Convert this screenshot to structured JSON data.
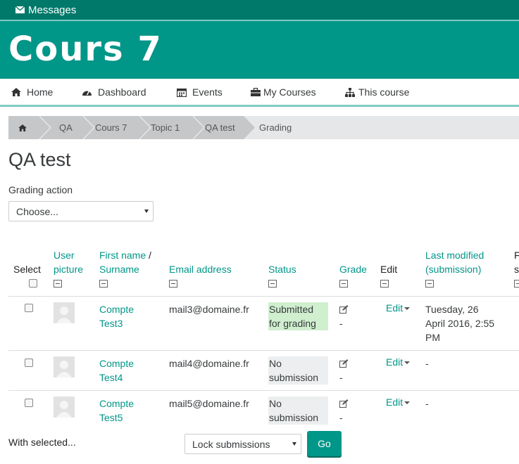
{
  "topbar": {
    "messages_label": "Messages",
    "icon": "envelope-icon"
  },
  "banner": {
    "title": "Cours 7"
  },
  "nav": {
    "items": [
      {
        "label": "Home",
        "icon": "home-icon"
      },
      {
        "label": "Dashboard",
        "icon": "dashboard-icon"
      },
      {
        "label": "Events",
        "icon": "calendar-icon"
      },
      {
        "label": "My Courses",
        "icon": "briefcase-icon"
      },
      {
        "label": "This course",
        "icon": "sitemap-icon"
      }
    ]
  },
  "breadcrumb": {
    "items": [
      "QA",
      "Cours 7",
      "Topic 1",
      "QA test",
      "Grading"
    ],
    "home_icon": "home-icon"
  },
  "page": {
    "title": "QA test",
    "grading_action_label": "Grading action",
    "grading_action_value": "Choose..."
  },
  "table": {
    "headers": {
      "select": "Select",
      "user_picture_1": "User",
      "user_picture_2": "picture",
      "first_name": "First name",
      "name_sep": " /",
      "surname": "Surname",
      "email": "Email address",
      "status": "Status",
      "grade": "Grade",
      "edit": "Edit",
      "last_modified_1": "Last modified",
      "last_modified_2": "(submission)",
      "cut_1": "F",
      "cut_2": "s"
    },
    "rows": [
      {
        "first": "Compte",
        "last": "Test3",
        "email": "mail3@domaine.fr",
        "status_1": "Submitted",
        "status_2": "for grading",
        "status_color": "#cfefcf",
        "grade": "-",
        "edit": "Edit",
        "modified_1": "Tuesday, 26",
        "modified_2": "April 2016, 2:55",
        "modified_3": "PM"
      },
      {
        "first": "Compte",
        "last": "Test4",
        "email": "mail4@domaine.fr",
        "status_1": "No",
        "status_2": "submission",
        "status_color": "#eceeef",
        "grade": "-",
        "edit": "Edit",
        "modified_1": "-"
      },
      {
        "first": "Compte",
        "last": "Test5",
        "email": "mail5@domaine.fr",
        "status_1": "No",
        "status_2": "submission",
        "status_color": "#eceeef",
        "grade": "-",
        "edit": "Edit",
        "modified_1": "-"
      }
    ]
  },
  "footer": {
    "with_selected": "With selected...",
    "bulk_action": "Lock submissions",
    "go": "Go"
  },
  "colors": {
    "brand": "#009688",
    "topbar": "#00796b",
    "accent_line": "#80cbc4"
  }
}
